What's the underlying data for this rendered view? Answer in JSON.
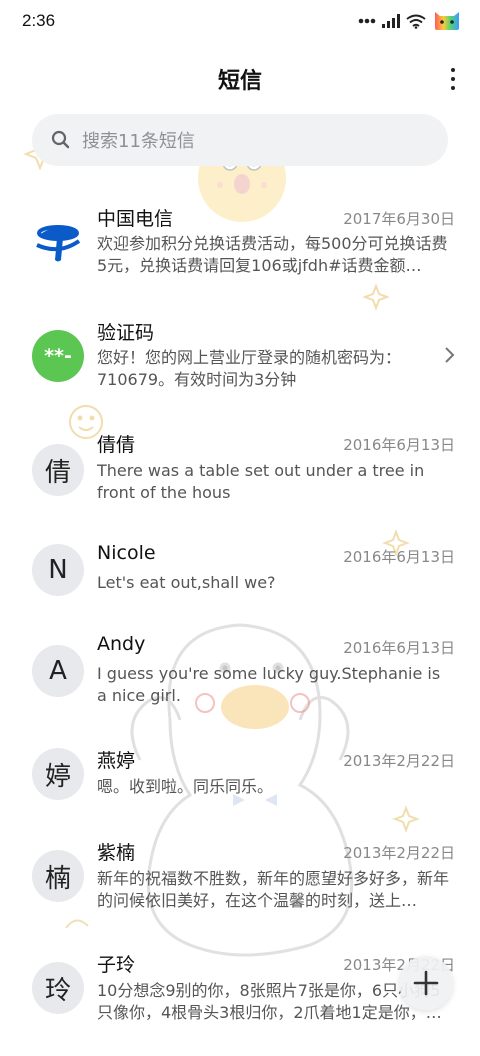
{
  "status_bar": {
    "time": "2:36",
    "icons": [
      "dots-icon",
      "signal-icon",
      "wifi-icon",
      "battery-icon"
    ]
  },
  "header": {
    "title": "短信",
    "more_icon": "more-vert-icon"
  },
  "search": {
    "placeholder": "搜索11条短信",
    "icon": "search-icon"
  },
  "conversations": [
    {
      "name": "中国电信",
      "date": "2017年6月30日",
      "preview": "欢迎参加积分兑换话费活动，每500分可兑换话费5元，兑换话费请回复106或jfdh#话费金额…",
      "avatar_type": "logo",
      "avatar_icon": "china-telecom-logo-icon",
      "avatar_color": "#0a5ac8"
    },
    {
      "name": "验证码",
      "date": "",
      "preview": "您好！您的网上营业厅登录的随机密码为：710679。有效时间为3分钟",
      "avatar_type": "badge",
      "avatar_text": "**-",
      "avatar_color": "#5cc653",
      "has_chevron": true
    },
    {
      "name": "倩倩",
      "date": "2016年6月13日",
      "preview": "There was a table set out under a tree in front of the hous",
      "avatar_type": "letter",
      "avatar_text": "倩"
    },
    {
      "name": "Nicole",
      "date": "2016年6月13日",
      "preview": "Let's eat out,shall we?",
      "avatar_type": "letter",
      "avatar_text": "N"
    },
    {
      "name": "Andy",
      "date": "2016年6月13日",
      "preview": "I guess you're some lucky guy.Stephanie is a nice girl.",
      "avatar_type": "letter",
      "avatar_text": "A"
    },
    {
      "name": "燕婷",
      "date": "2013年2月22日",
      "preview": "嗯。收到啦。同乐同乐。",
      "avatar_type": "letter",
      "avatar_text": "婷"
    },
    {
      "name": "紫楠",
      "date": "2013年2月22日",
      "preview": "新年的祝福数不胜数，新年的愿望好多好多，新年的问候依旧美好，在这个温馨的时刻，送上…",
      "avatar_type": "letter",
      "avatar_text": "楠"
    },
    {
      "name": "子玲",
      "date": "2013年2月22日",
      "preview": "10分想念9别的你，8张照片7张是你，6只小狗5只像你，4根骨头3根归你，2爪着地1定是你，…",
      "avatar_type": "letter",
      "avatar_text": "玲"
    }
  ],
  "fab": {
    "icon": "plus-icon"
  },
  "colors": {
    "accent_blue": "#0a5ac8",
    "badge_green": "#5cc653",
    "avatar_bg": "#e7e9ec",
    "search_bg": "#f1f2f4"
  }
}
